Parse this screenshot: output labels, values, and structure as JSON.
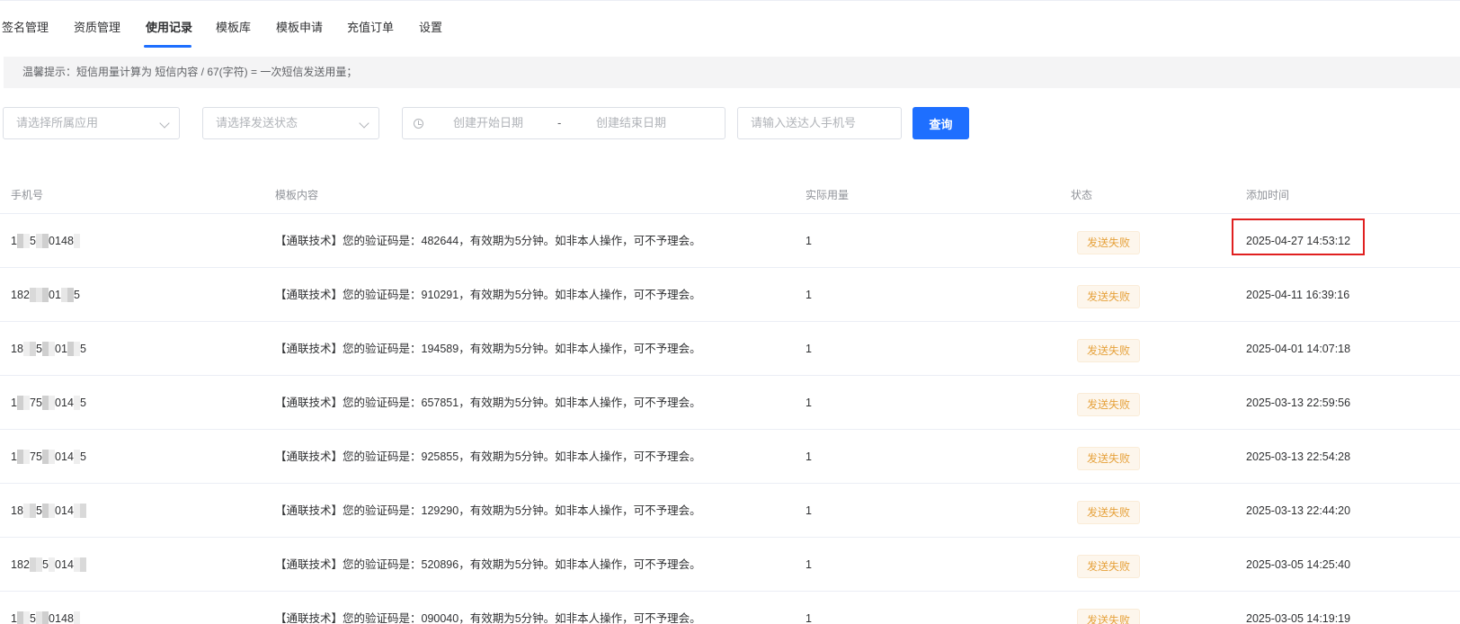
{
  "tabs": [
    {
      "label": "签名管理"
    },
    {
      "label": "资质管理"
    },
    {
      "label": "使用记录",
      "active": true
    },
    {
      "label": "模板库"
    },
    {
      "label": "模板申请"
    },
    {
      "label": "充值订单"
    },
    {
      "label": "设置"
    }
  ],
  "notice": {
    "text": "温馨提示：短信用量计算为 短信内容 / 67(字符) = 一次短信发送用量；"
  },
  "filters": {
    "app_placeholder": "请选择所属应用",
    "status_placeholder": "请选择发送状态",
    "start_date_placeholder": "创建开始日期",
    "date_separator": "-",
    "end_date_placeholder": "创建结束日期",
    "phone_placeholder": "请输入送达人手机号",
    "query_label": "查询"
  },
  "table": {
    "headers": {
      "phone": "手机号",
      "content": "模板内容",
      "usage": "实际用量",
      "status": "状态",
      "time": "添加时间"
    },
    "rows": [
      {
        "phone": "1··5··0148·",
        "content": "【通联技术】您的验证码是：482644，有效期为5分钟。如非本人操作，可不予理会。",
        "usage": "1",
        "status": "发送失败",
        "time": "2025-04-27 14:53:12"
      },
      {
        "phone": "182···01··5",
        "content": "【通联技术】您的验证码是：910291，有效期为5分钟。如非本人操作，可不予理会。",
        "usage": "1",
        "status": "发送失败",
        "time": "2025-04-11 16:39:16"
      },
      {
        "phone": "18··5··01··5",
        "content": "【通联技术】您的验证码是：194589，有效期为5分钟。如非本人操作，可不予理会。",
        "usage": "1",
        "status": "发送失败",
        "time": "2025-04-01 14:07:18"
      },
      {
        "phone": "1··75··014·5",
        "content": "【通联技术】您的验证码是：657851，有效期为5分钟。如非本人操作，可不予理会。",
        "usage": "1",
        "status": "发送失败",
        "time": "2025-03-13 22:59:56"
      },
      {
        "phone": "1··75··014·5",
        "content": "【通联技术】您的验证码是：925855，有效期为5分钟。如非本人操作，可不予理会。",
        "usage": "1",
        "status": "发送失败",
        "time": "2025-03-13 22:54:28"
      },
      {
        "phone": "18··5··014··",
        "content": "【通联技术】您的验证码是：129290，有效期为5分钟。如非本人操作，可不予理会。",
        "usage": "1",
        "status": "发送失败",
        "time": "2025-03-13 22:44:20"
      },
      {
        "phone": "182··5·014··",
        "content": "【通联技术】您的验证码是：520896，有效期为5分钟。如非本人操作，可不予理会。",
        "usage": "1",
        "status": "发送失败",
        "time": "2025-03-05 14:25:40"
      },
      {
        "phone": "1··5··0148·",
        "content": "【通联技术】您的验证码是：090040，有效期为5分钟。如非本人操作，可不予理会。",
        "usage": "1",
        "status": "发送失败",
        "time": "2025-03-05 14:19:19"
      }
    ]
  },
  "colors": {
    "accent": "#1e6fff",
    "status_failed_text": "#e6a23c",
    "status_failed_bg": "#fdf6ec",
    "highlight": "#e02020"
  }
}
